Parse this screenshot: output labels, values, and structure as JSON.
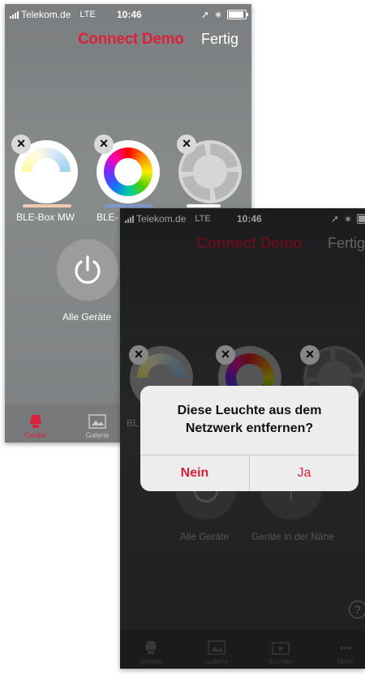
{
  "colors": {
    "accent": "#d9213a",
    "text": "#ffffff"
  },
  "status": {
    "carrier": "Telekom.de",
    "network": "LTE",
    "time": "10:46"
  },
  "phone_a": {
    "title": "Connect Demo",
    "done": "Fertig",
    "devices": [
      {
        "label": "BLE-Box MW",
        "type": "tunable-white"
      },
      {
        "label": "BLE-",
        "type": "rgb"
      },
      {
        "label": "",
        "type": "grey"
      }
    ],
    "all_devices": "Alle Geräte",
    "tabs": [
      {
        "label": "Geräte",
        "icon": "lamp-icon"
      },
      {
        "label": "Galerie",
        "icon": "gallery-icon"
      }
    ]
  },
  "phone_b": {
    "title": "Connect Demo",
    "done": "Fertig",
    "device_label_stub": "BL",
    "all_devices": "Alle Geräte",
    "nearby": "Geräte in der Nähe",
    "help": "?",
    "tabs": [
      {
        "label": "Geräte",
        "icon": "lamp-icon"
      },
      {
        "label": "Galerie",
        "icon": "gallery-icon"
      },
      {
        "label": "Szenen",
        "icon": "scenes-icon"
      },
      {
        "label": "Mehr",
        "icon": "more-icon"
      }
    ],
    "alert": {
      "message": "Diese Leuchte aus dem Netzwerk entfernen?",
      "cancel": "Nein",
      "confirm": "Ja"
    }
  }
}
